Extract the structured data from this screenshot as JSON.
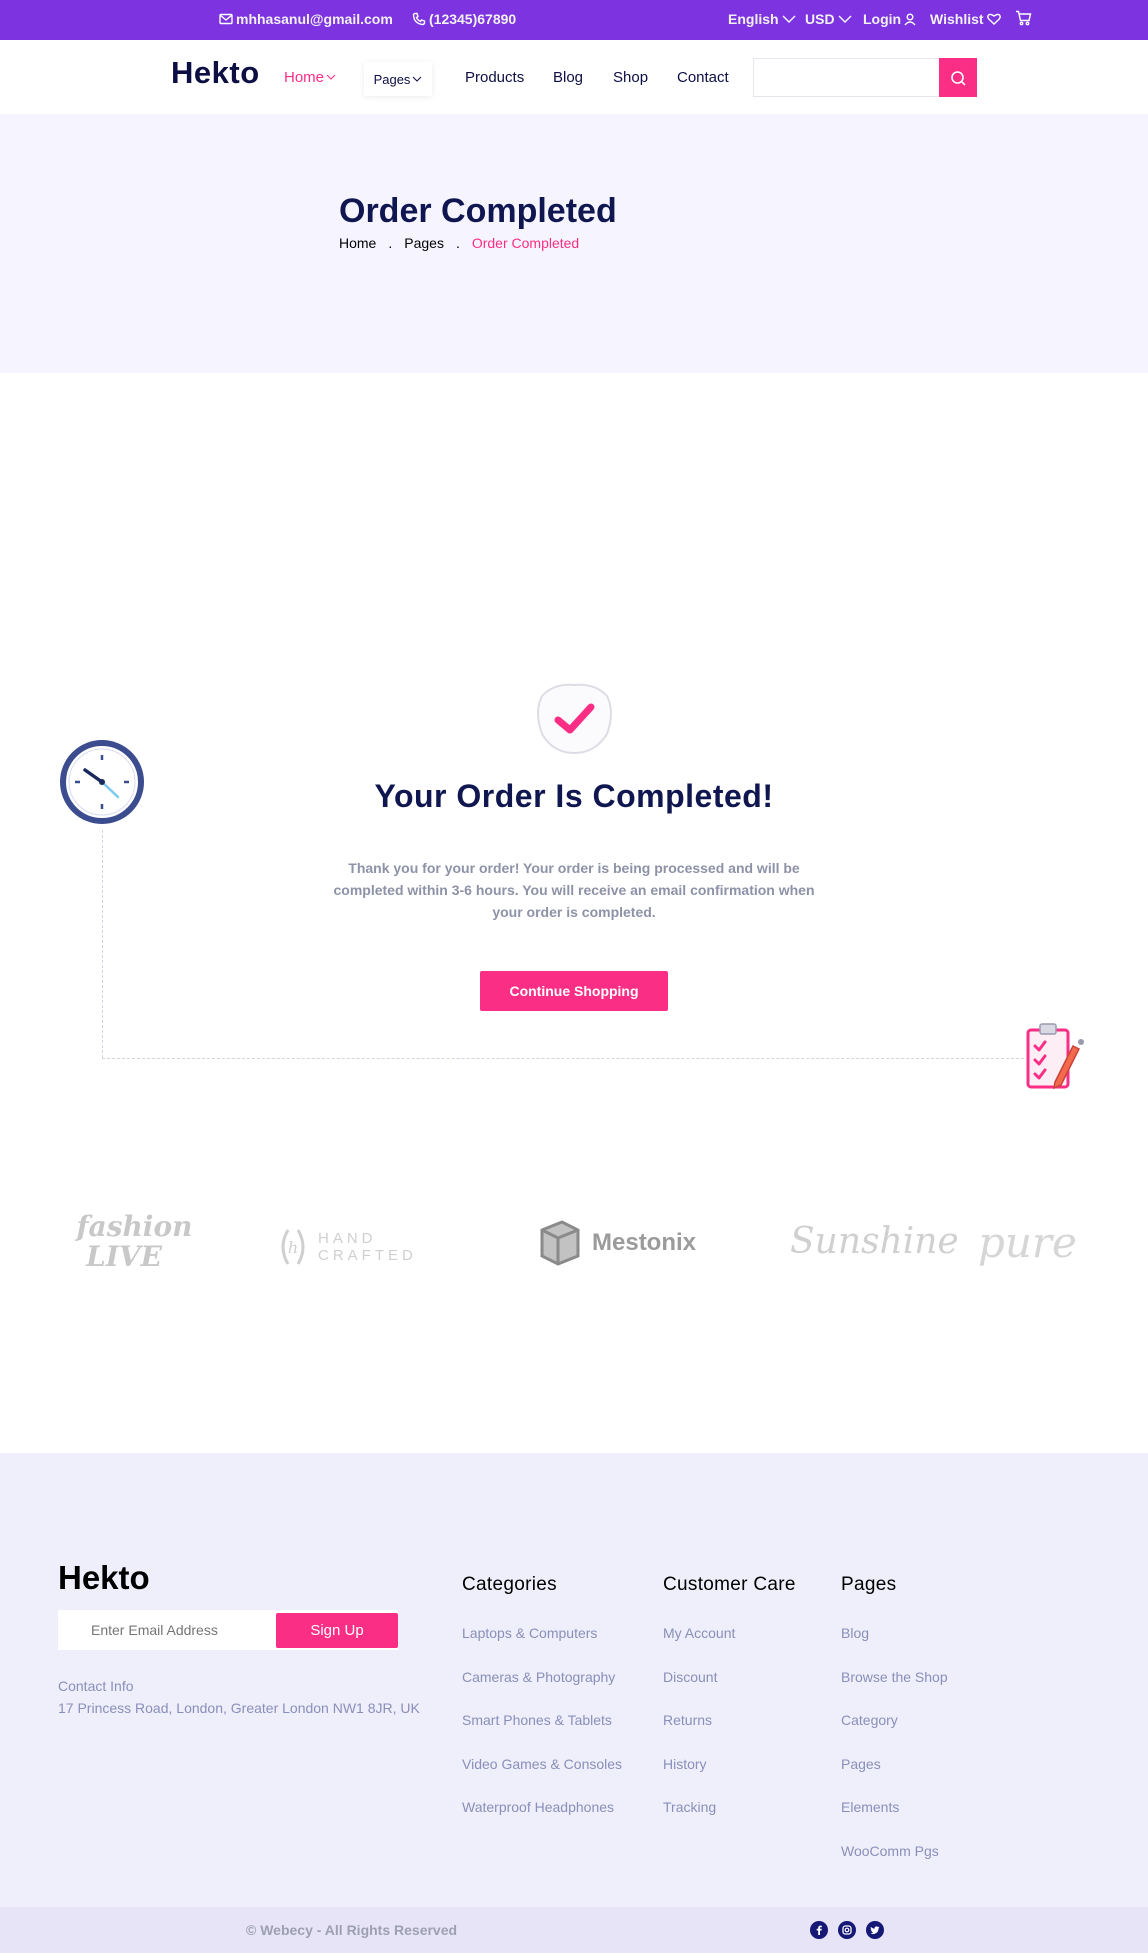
{
  "topbar": {
    "email": "mhhasanul@gmail.com",
    "phone": "(12345)67890",
    "language": "English",
    "currency": "USD",
    "login": "Login",
    "wishlist": "Wishlist"
  },
  "nav": {
    "logo": "Hekto",
    "home": "Home",
    "pages": "Pages",
    "products": "Products",
    "blog": "Blog",
    "shop": "Shop",
    "contact": "Contact",
    "search_value": ""
  },
  "hero": {
    "title": "Order Completed",
    "breadcrumb": [
      "Home",
      ".",
      "Pages",
      ".",
      "Order Completed"
    ]
  },
  "main": {
    "title": "Your Order Is Completed!",
    "message": "Thank you for your order! Your order is being processed and will be completed within 3-6 hours. You will receive an email confirmation when your order is completed.",
    "cta": "Continue Shopping"
  },
  "brands": [
    "fashion LIVE",
    "HAND CRAFTED",
    "Mestonix",
    "Sunshine",
    "pure"
  ],
  "footer": {
    "logo": "Hekto",
    "email_placeholder": "Enter Email Address",
    "signup": "Sign Up",
    "contact_label": "Contact Info",
    "address": "17 Princess Road, London, Greater London NW1 8JR, UK",
    "columns": [
      {
        "title": "Categories",
        "links": [
          "Laptops & Computers",
          "Cameras & Photography",
          "Smart Phones & Tablets",
          "Video Games & Consoles",
          "Waterproof Headphones"
        ]
      },
      {
        "title": "Customer Care",
        "links": [
          "My Account",
          "Discount",
          "Returns",
          "History",
          "Tracking"
        ]
      },
      {
        "title": "Pages",
        "links": [
          "Blog",
          "Browse the Shop",
          "Category",
          "Pages",
          "Elements",
          "WooComm Pgs"
        ]
      }
    ],
    "copyright": "© Webecy - All Rights Reserved",
    "social_icons": [
      "facebook-icon",
      "instagram-icon",
      "twitter-icon"
    ]
  },
  "colors": {
    "topbar": "#7e33e0",
    "accent": "#fb2e86",
    "navy": "#101750",
    "hero_bg": "#f6f5ff",
    "footer_bg": "#eeeffb"
  }
}
